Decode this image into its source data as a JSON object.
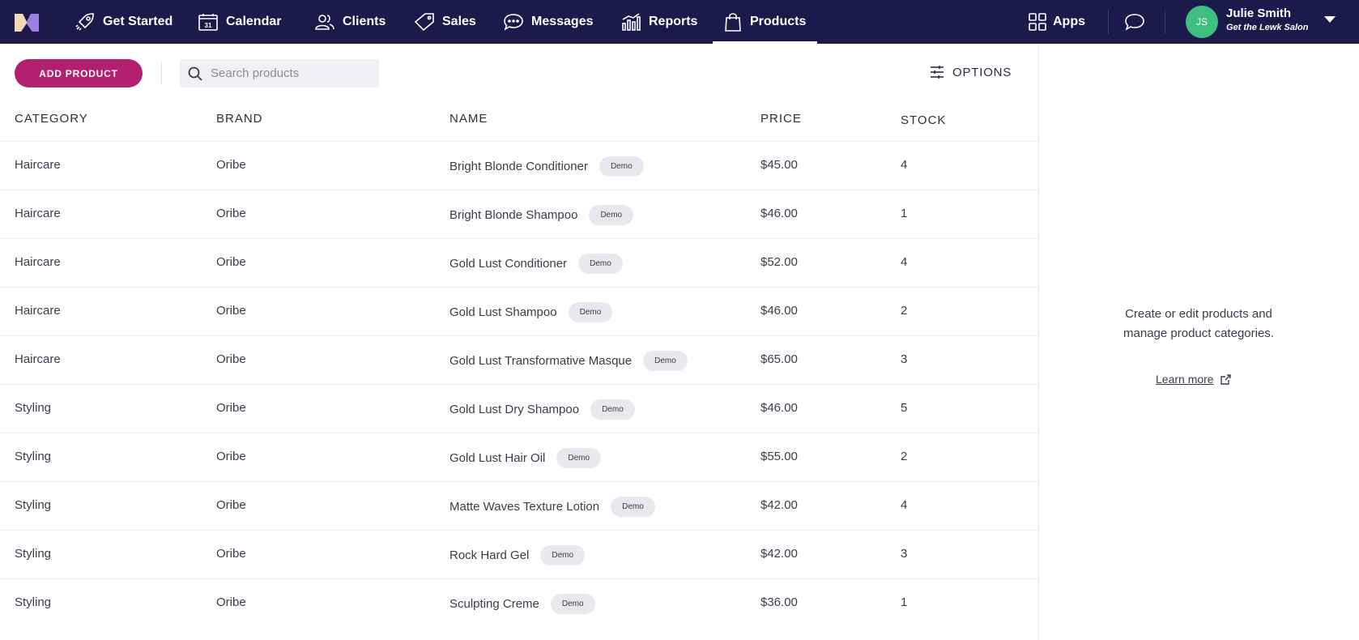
{
  "nav": {
    "items": [
      {
        "label": "Get Started",
        "icon": "rocket-icon"
      },
      {
        "label": "Calendar",
        "icon": "calendar-icon"
      },
      {
        "label": "Clients",
        "icon": "clients-icon"
      },
      {
        "label": "Sales",
        "icon": "tag-icon"
      },
      {
        "label": "Messages",
        "icon": "message-icon"
      },
      {
        "label": "Reports",
        "icon": "chart-icon"
      },
      {
        "label": "Products",
        "icon": "bag-icon",
        "active": true
      }
    ],
    "apps_label": "Apps",
    "calendar_day": "31"
  },
  "user": {
    "initials": "JS",
    "name": "Julie Smith",
    "salon": "Get the Lewk Salon"
  },
  "toolbar": {
    "add_label": "ADD PRODUCT",
    "search_placeholder": "Search products",
    "options_label": "OPTIONS"
  },
  "table": {
    "headers": {
      "category": "CATEGORY",
      "brand": "BRAND",
      "name": "NAME",
      "price": "PRICE",
      "stock": "STOCK"
    },
    "rows": [
      {
        "category": "Haircare",
        "brand": "Oribe",
        "name": "Bright Blonde Conditioner",
        "badge": "Demo",
        "price": "$45.00",
        "stock": "4"
      },
      {
        "category": "Haircare",
        "brand": "Oribe",
        "name": "Bright Blonde Shampoo",
        "badge": "Demo",
        "price": "$46.00",
        "stock": "1"
      },
      {
        "category": "Haircare",
        "brand": "Oribe",
        "name": "Gold Lust Conditioner",
        "badge": "Demo",
        "price": "$52.00",
        "stock": "4"
      },
      {
        "category": "Haircare",
        "brand": "Oribe",
        "name": "Gold Lust Shampoo",
        "badge": "Demo",
        "price": "$46.00",
        "stock": "2"
      },
      {
        "category": "Haircare",
        "brand": "Oribe",
        "name": "Gold Lust Transformative Masque",
        "badge": "Demo",
        "price": "$65.00",
        "stock": "3"
      },
      {
        "category": "Styling",
        "brand": "Oribe",
        "name": "Gold Lust Dry Shampoo",
        "badge": "Demo",
        "price": "$46.00",
        "stock": "5"
      },
      {
        "category": "Styling",
        "brand": "Oribe",
        "name": "Gold Lust Hair Oil",
        "badge": "Demo",
        "price": "$55.00",
        "stock": "2"
      },
      {
        "category": "Styling",
        "brand": "Oribe",
        "name": "Matte Waves Texture Lotion",
        "badge": "Demo",
        "price": "$42.00",
        "stock": "4"
      },
      {
        "category": "Styling",
        "brand": "Oribe",
        "name": "Rock Hard Gel",
        "badge": "Demo",
        "price": "$42.00",
        "stock": "3"
      },
      {
        "category": "Styling",
        "brand": "Oribe",
        "name": "Sculpting Creme",
        "badge": "Demo",
        "price": "$36.00",
        "stock": "1"
      }
    ]
  },
  "panel": {
    "line1": "Create or edit products and",
    "line2": "manage product categories.",
    "learn_more": "Learn more"
  },
  "colors": {
    "nav_bg": "#1c1a4b",
    "accent": "#b3206f",
    "avatar": "#3fbf7f"
  }
}
